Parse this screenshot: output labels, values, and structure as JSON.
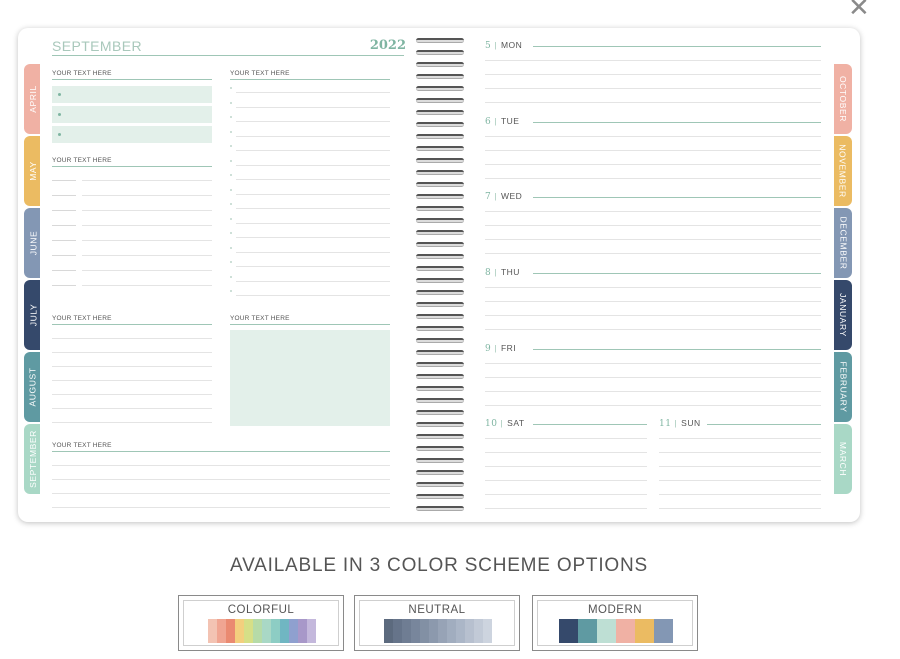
{
  "close_icon": "close-icon",
  "planner": {
    "left_page": {
      "month": "SEPTEMBER",
      "year": "2022",
      "section_labels": [
        "YOUR TEXT HERE",
        "YOUR TEXT HERE",
        "YOUR TEXT HERE",
        "YOUR TEXT HERE",
        "YOUR TEXT HERE",
        "YOUR TEXT HERE"
      ]
    },
    "left_tabs": [
      {
        "label": "APRIL",
        "color": "#f0b1a4"
      },
      {
        "label": "MAY",
        "color": "#ebbb62"
      },
      {
        "label": "JUNE",
        "color": "#8397b4"
      },
      {
        "label": "JULY",
        "color": "#35496b"
      },
      {
        "label": "AUGUST",
        "color": "#5f9aa2"
      },
      {
        "label": "SEPTEMBER",
        "color": "#a9d8c6"
      }
    ],
    "right_tabs": [
      {
        "label": "OCTOBER",
        "color": "#f0b1a4"
      },
      {
        "label": "NOVEMBER",
        "color": "#ebbb62"
      },
      {
        "label": "DECEMBER",
        "color": "#8397b4"
      },
      {
        "label": "JANUARY",
        "color": "#35496b"
      },
      {
        "label": "FEBRUARY",
        "color": "#5f9aa2"
      },
      {
        "label": "MARCH",
        "color": "#a9d8c6"
      }
    ],
    "days": [
      {
        "num": "5",
        "name": "MON"
      },
      {
        "num": "6",
        "name": "TUE"
      },
      {
        "num": "7",
        "name": "WED"
      },
      {
        "num": "8",
        "name": "THU"
      },
      {
        "num": "9",
        "name": "FRI"
      },
      {
        "num": "10",
        "name": "SAT"
      },
      {
        "num": "11",
        "name": "SUN"
      }
    ]
  },
  "color_schemes": {
    "heading": "AVAILABLE IN 3 COLOR SCHEME OPTIONS",
    "options": [
      {
        "label": "COLORFUL",
        "swatches": [
          "#f3c3b3",
          "#f0a592",
          "#ea8a71",
          "#f3cf7e",
          "#d6df87",
          "#b6dba8",
          "#a9d8c6",
          "#8dcdc4",
          "#70b6c2",
          "#8fa0cf",
          "#a898c9",
          "#c4b8dc"
        ]
      },
      {
        "label": "NEUTRAL",
        "swatches": [
          "#5c6a7e",
          "#66748a",
          "#6f7d93",
          "#78869c",
          "#8290a4",
          "#8c99ad",
          "#97a3b6",
          "#a1adbf",
          "#abb6c7",
          "#b7c0cf",
          "#c2cad7",
          "#cdd4df"
        ]
      },
      {
        "label": "MODERN",
        "swatches": [
          "#35496b",
          "#5f9aa2",
          "#bedfd4",
          "#f0b1a4",
          "#ebbb62",
          "#8397b4"
        ]
      }
    ]
  }
}
